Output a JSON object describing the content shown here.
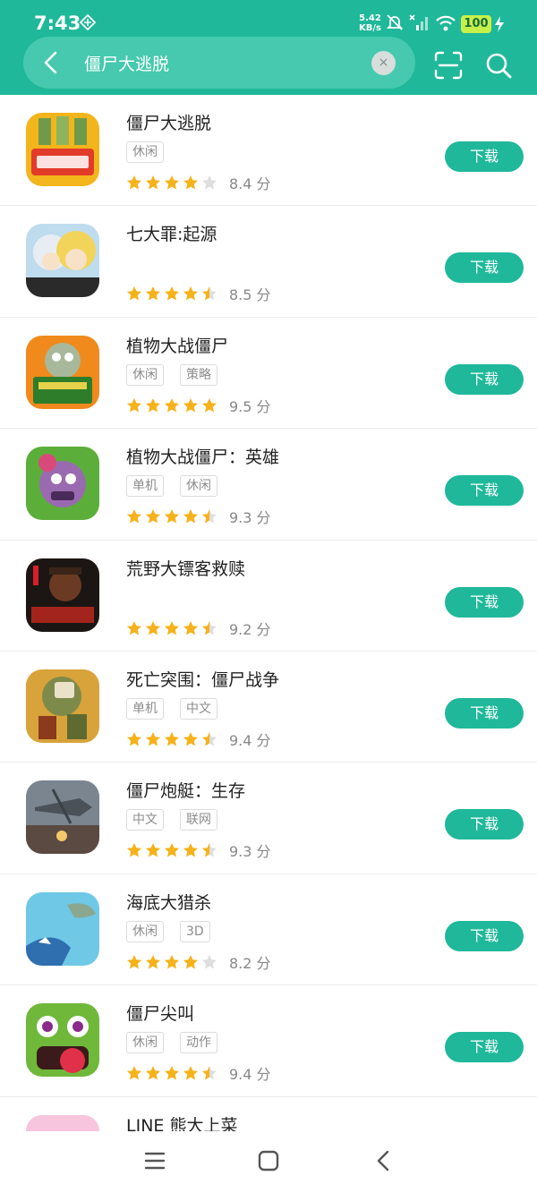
{
  "status_bar": {
    "time": "7:43",
    "net_speed_value": "5.42",
    "net_speed_unit": "KB/s",
    "battery": "100",
    "icons": [
      "app-notification-icon",
      "mute-icon",
      "signal-icon",
      "wifi-icon",
      "charging-icon"
    ]
  },
  "search": {
    "query": "僵尸大逃脱",
    "clear_label": "×"
  },
  "colors": {
    "accent": "#1fb89a",
    "star": "#f6b21b",
    "star_empty": "#dedede"
  },
  "results": [
    {
      "name": "僵尸大逃脱",
      "tags": [
        "休闲"
      ],
      "stars": 4,
      "score": "8.4 分",
      "button": "下载"
    },
    {
      "name": "七大罪:起源",
      "tags": [],
      "stars": 4.5,
      "score": "8.5 分",
      "button": "下载"
    },
    {
      "name": "植物大战僵尸",
      "tags": [
        "休闲",
        "策略"
      ],
      "stars": 5,
      "score": "9.5 分",
      "button": "下载"
    },
    {
      "name": "植物大战僵尸：英雄",
      "tags": [
        "单机",
        "休闲"
      ],
      "stars": 4.5,
      "score": "9.3 分",
      "button": "下载"
    },
    {
      "name": "荒野大镖客救赎",
      "tags": [],
      "stars": 4.5,
      "score": "9.2 分",
      "button": "下载"
    },
    {
      "name": "死亡突围：僵尸战争",
      "tags": [
        "单机",
        "中文"
      ],
      "stars": 4.5,
      "score": "9.4 分",
      "button": "下载"
    },
    {
      "name": "僵尸炮艇：生存",
      "tags": [
        "中文",
        "联网"
      ],
      "stars": 4.5,
      "score": "9.3 分",
      "button": "下载"
    },
    {
      "name": "海底大猎杀",
      "tags": [
        "休闲",
        "3D"
      ],
      "stars": 4,
      "score": "8.2 分",
      "button": "下载"
    },
    {
      "name": "僵尸尖叫",
      "tags": [
        "休闲",
        "动作"
      ],
      "stars": 4.5,
      "score": "9.4 分",
      "button": "下载"
    },
    {
      "name": "LINE 熊大上菜",
      "tags": [],
      "stars": 0,
      "score": "",
      "button": ""
    }
  ]
}
